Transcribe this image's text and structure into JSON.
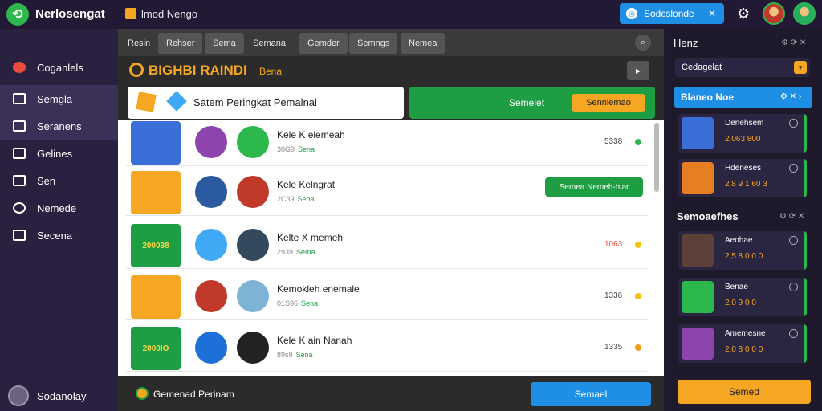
{
  "app": {
    "title": "Nerlosengat",
    "mod_label": "lmod Nengo"
  },
  "topbar": {
    "search_label": "Sodcslonde",
    "close": "✕"
  },
  "sidebar": {
    "items": [
      {
        "label": "Coganlels"
      },
      {
        "label": "Semgla"
      },
      {
        "label": "Seranens"
      },
      {
        "label": "Gelines"
      },
      {
        "label": "Sen"
      },
      {
        "label": "Nemede"
      },
      {
        "label": "Secena"
      }
    ],
    "user": "Sodanolay"
  },
  "tabs": [
    "Resin",
    "Rehser",
    "Sema",
    "Semana",
    "Gemder",
    "Semngs",
    "Nemea"
  ],
  "header": {
    "title": "BIGHBI RAINDI",
    "sub": "Bena",
    "btn": "▸"
  },
  "panel": {
    "title": "Satem Peringkat Pemalnai",
    "green_label": "Semeiet",
    "green_button": "Senniemao"
  },
  "rows": [
    {
      "name": "Kele K elemeah",
      "meta": "30G9",
      "meta_green": "Sena",
      "score": "5338"
    },
    {
      "name": "Kele Kelngrat",
      "meta": "2C39",
      "meta_green": "Sena",
      "action": "Semea Nemeh-hiar"
    },
    {
      "name": "Kelte X memeh",
      "meta": "2939",
      "meta_green": "Sema",
      "score": "1063"
    },
    {
      "name": "Kemokleh enemale",
      "meta": "01S96",
      "meta_green": "Sena",
      "score": "1336"
    },
    {
      "name": "Kele K ain Nanah",
      "meta": "89s9",
      "meta_green": "Sena",
      "score": "1335"
    }
  ],
  "row_thumb_text": [
    "",
    "",
    "200038",
    "",
    "2000IO"
  ],
  "footer": {
    "text": "Gemenad Perinam",
    "button": "Semael"
  },
  "right": {
    "header": "Henz",
    "icons": "⚙ ⟳ ✕",
    "select": "Cedagelat",
    "blue": "Blaneo Noe",
    "blue_icons": "⚙ ✕ ›",
    "top_cards": [
      {
        "name": "Denehsem",
        "value": "2.063 800"
      },
      {
        "name": "Hdeneses",
        "value": "2.8 9 1 60 3"
      }
    ],
    "section": "Semoaefhes",
    "section_icons": "⚙ ⟳ ✕",
    "cards": [
      {
        "name": "Aeohae",
        "value": "2.5 8 0 0 0"
      },
      {
        "name": "Benae",
        "value": "2.0 9 0 0"
      },
      {
        "name": "Amemesne",
        "value": "2.0 8 0 0 0"
      }
    ],
    "button": "Semed"
  }
}
